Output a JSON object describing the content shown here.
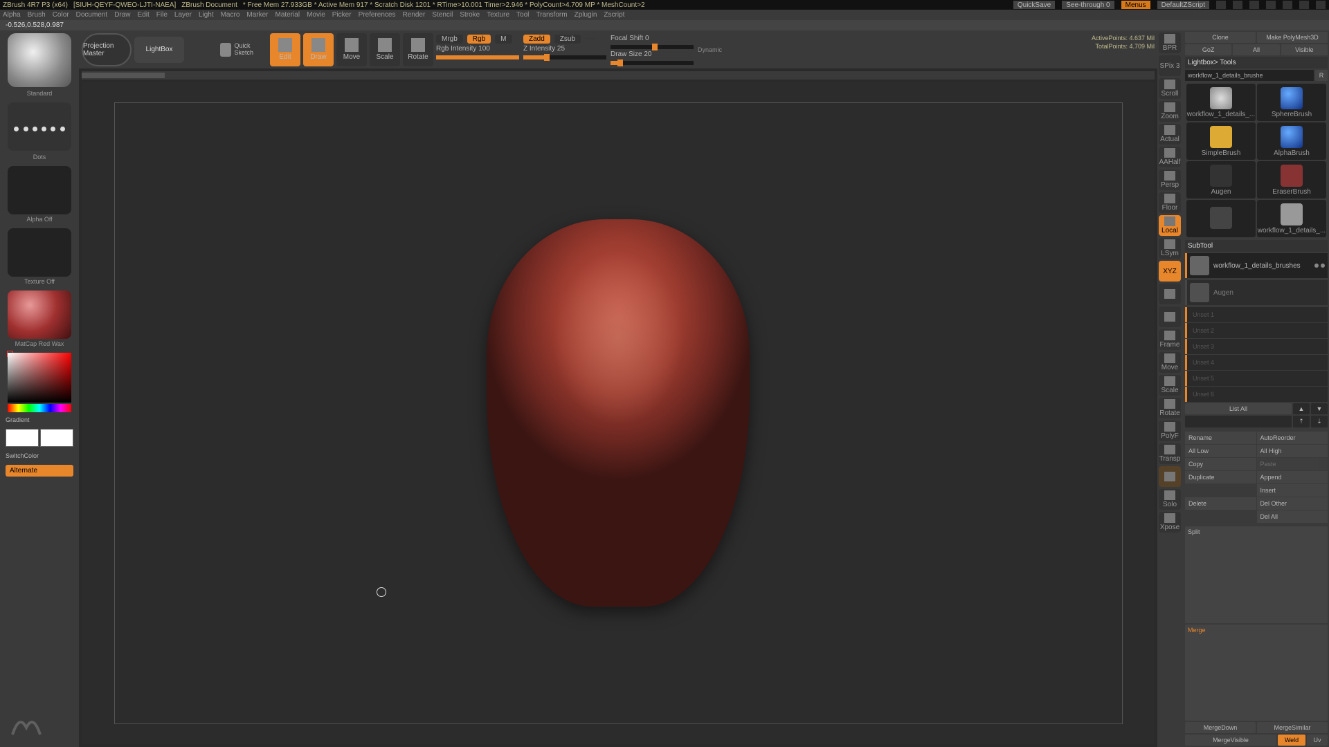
{
  "title_bar": {
    "app": "ZBrush 4R7 P3 (x64)",
    "doc": "[SIUH-QEYF-QWEO-LJTI-NAEA]",
    "doctype": "ZBrush Document",
    "stats": "* Free Mem 27.933GB * Active Mem 917 * Scratch Disk 1201 * RTime>10.001 Timer>2.946 * PolyCount>4.709 MP * MeshCount>2",
    "quicksave": "QuickSave",
    "seethrough": "See-through  0",
    "menus": "Menus",
    "defaultscript": "DefaultZScript"
  },
  "menus": [
    "Alpha",
    "Brush",
    "Color",
    "Document",
    "Draw",
    "Edit",
    "File",
    "Layer",
    "Light",
    "Macro",
    "Marker",
    "Material",
    "Movie",
    "Picker",
    "Preferences",
    "Render",
    "Stencil",
    "Stroke",
    "Texture",
    "Tool",
    "Transform",
    "Zplugin",
    "Zscript"
  ],
  "coords": "-0.526,0.528,0.987",
  "top_tools": {
    "proj_master": "Projection Master",
    "lightbox": "LightBox",
    "quick_sketch": "Quick Sketch",
    "modes": [
      {
        "label": "Edit",
        "active": true
      },
      {
        "label": "Draw",
        "active": true
      },
      {
        "label": "Move",
        "active": false
      },
      {
        "label": "Scale",
        "active": false
      },
      {
        "label": "Rotate",
        "active": false
      }
    ],
    "mrgb": {
      "mrgb": "Mrgb",
      "rgb": "Rgb",
      "m": "M",
      "intensity": "Rgb Intensity 100"
    },
    "z": {
      "zadd": "Zadd",
      "zsub": "Zsub",
      "zcut": "",
      "intensity": "Z Intensity 25"
    },
    "focal": "Focal Shift 0",
    "draw_size": "Draw Size 20",
    "dynamic": "Dynamic",
    "active_pts": "ActivePoints: 4.637 Mil",
    "total_pts": "TotalPoints: 4.709 Mil"
  },
  "left": {
    "brush": "Standard",
    "stroke": "Dots",
    "alpha": "Alpha Off",
    "texture": "Texture Off",
    "material": "MatCap Red Wax",
    "gradient": "Gradient",
    "switchcolor": "SwitchColor",
    "alternate": "Alternate"
  },
  "nav": [
    "BPR",
    "SPix 3",
    "Scroll",
    "Zoom",
    "Actual",
    "AAHalf",
    "Persp",
    "Floor",
    "Local",
    "LSym",
    "XYZ",
    "",
    "",
    "Frame",
    "Move",
    "Scale",
    "Rotate",
    "PolyF",
    "Transp",
    "",
    "Solo",
    "Xpose"
  ],
  "right": {
    "clone": "Clone",
    "make_poly": "Make PolyMesh3D",
    "goz": "GoZ",
    "all": "All",
    "visible": "Visible",
    "lightbox_tools": "Lightbox> Tools",
    "tool_path": "workflow_1_details_brushe",
    "r": "R",
    "tools": [
      "workflow_1_details_...",
      "SphereBrush",
      "SimpleBrush",
      "AlphaBrush",
      "Augen",
      "EraserBrush",
      "",
      "workflow_1_details_..."
    ],
    "subtool": "SubTool",
    "subtool_items": [
      {
        "name": "workflow_1_details_brushes"
      },
      {
        "name": "Augen"
      }
    ],
    "unset": [
      "Unset 1",
      "Unset 2",
      "Unset 3",
      "Unset 4",
      "Unset 5",
      "Unset 6"
    ],
    "list_all": "List All",
    "actions": [
      [
        "Rename",
        "AutoReorder"
      ],
      [
        "All Low",
        "All High"
      ],
      [
        "Copy",
        "Paste"
      ],
      [
        "Duplicate",
        "Append"
      ],
      [
        "",
        "Insert"
      ],
      [
        "Delete",
        "Del Other"
      ],
      [
        "",
        "Del All"
      ]
    ],
    "split": "Split",
    "merge": "Merge",
    "merge_down": "MergeDown",
    "merge_similar": "MergeSimilar",
    "merge_visible": "MergeVisible",
    "weld": "Weld",
    "uv": "Uv"
  }
}
